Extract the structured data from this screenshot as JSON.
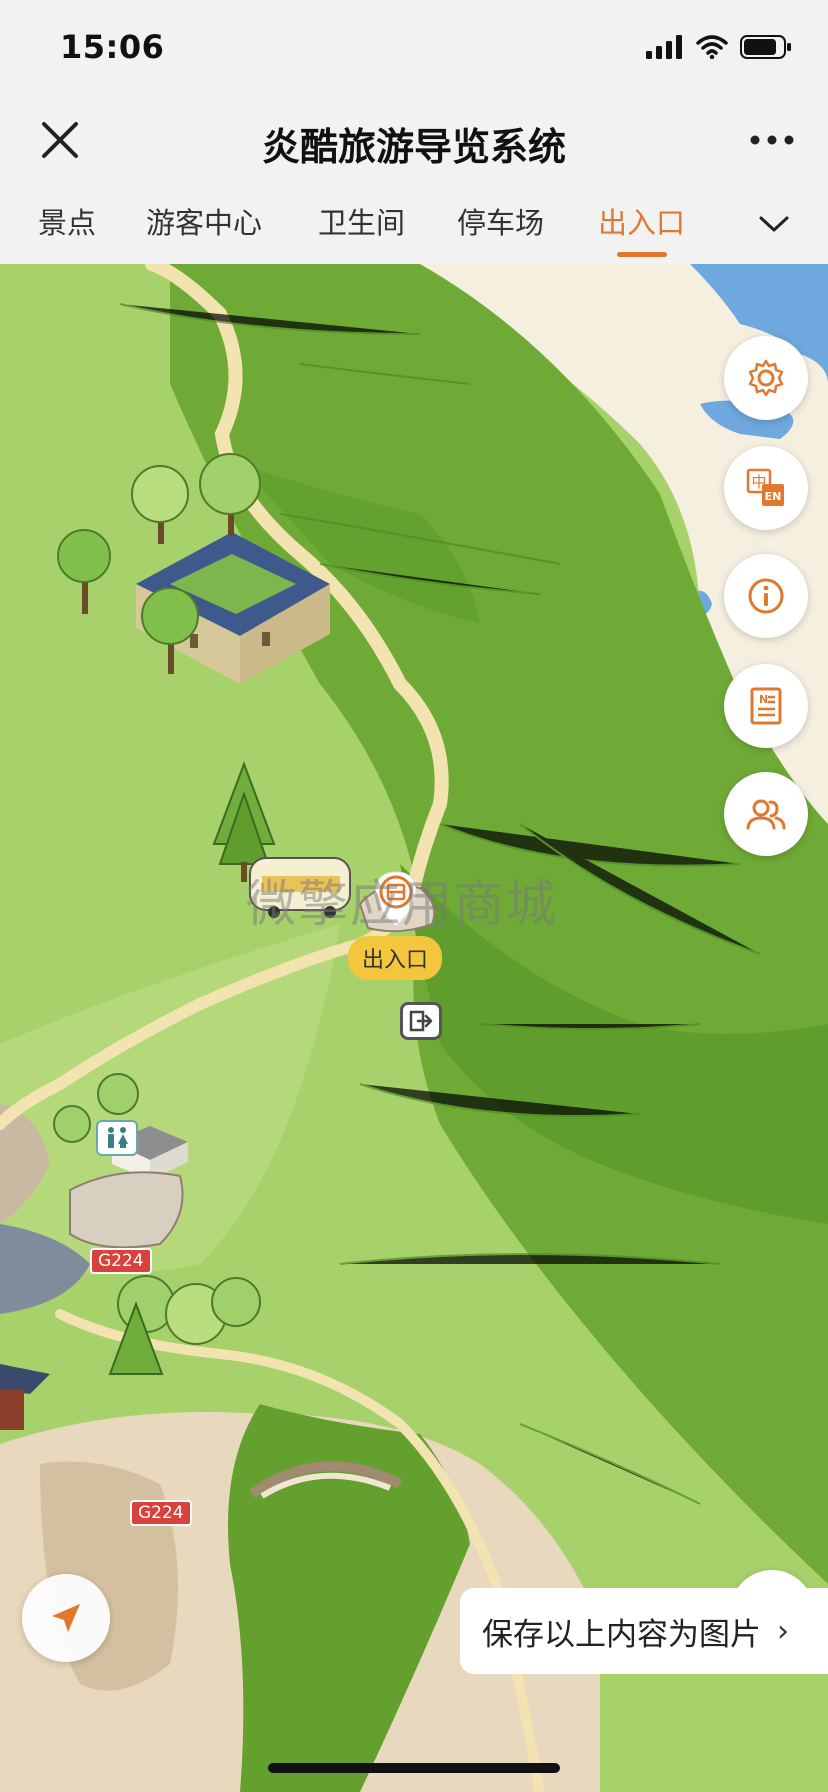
{
  "status_bar": {
    "time": "15:06"
  },
  "header": {
    "title": "炎酷旅游导览系统"
  },
  "tabs": [
    {
      "label": "景点"
    },
    {
      "label": "游客中心"
    },
    {
      "label": "卫生间"
    },
    {
      "label": "停车场"
    },
    {
      "label": "出入口",
      "active": true
    }
  ],
  "map": {
    "marker_label": "出入口",
    "watermark": "微擎应用商城",
    "road_signs": [
      "G224",
      "G224"
    ],
    "side_buttons": [
      "settings-icon",
      "language-zh-en-icon",
      "info-icon",
      "news-icon",
      "users-icon"
    ]
  },
  "save_banner": {
    "label": "保存以上内容为图片",
    "chevron": "›"
  },
  "colors": {
    "accent": "#e0782e",
    "marker_label_bg": "#f4c63d",
    "grass_light": "#a7d16a",
    "grass_dark": "#5f9e2c",
    "path": "#f3e3b0",
    "water": "#6fa8de"
  }
}
